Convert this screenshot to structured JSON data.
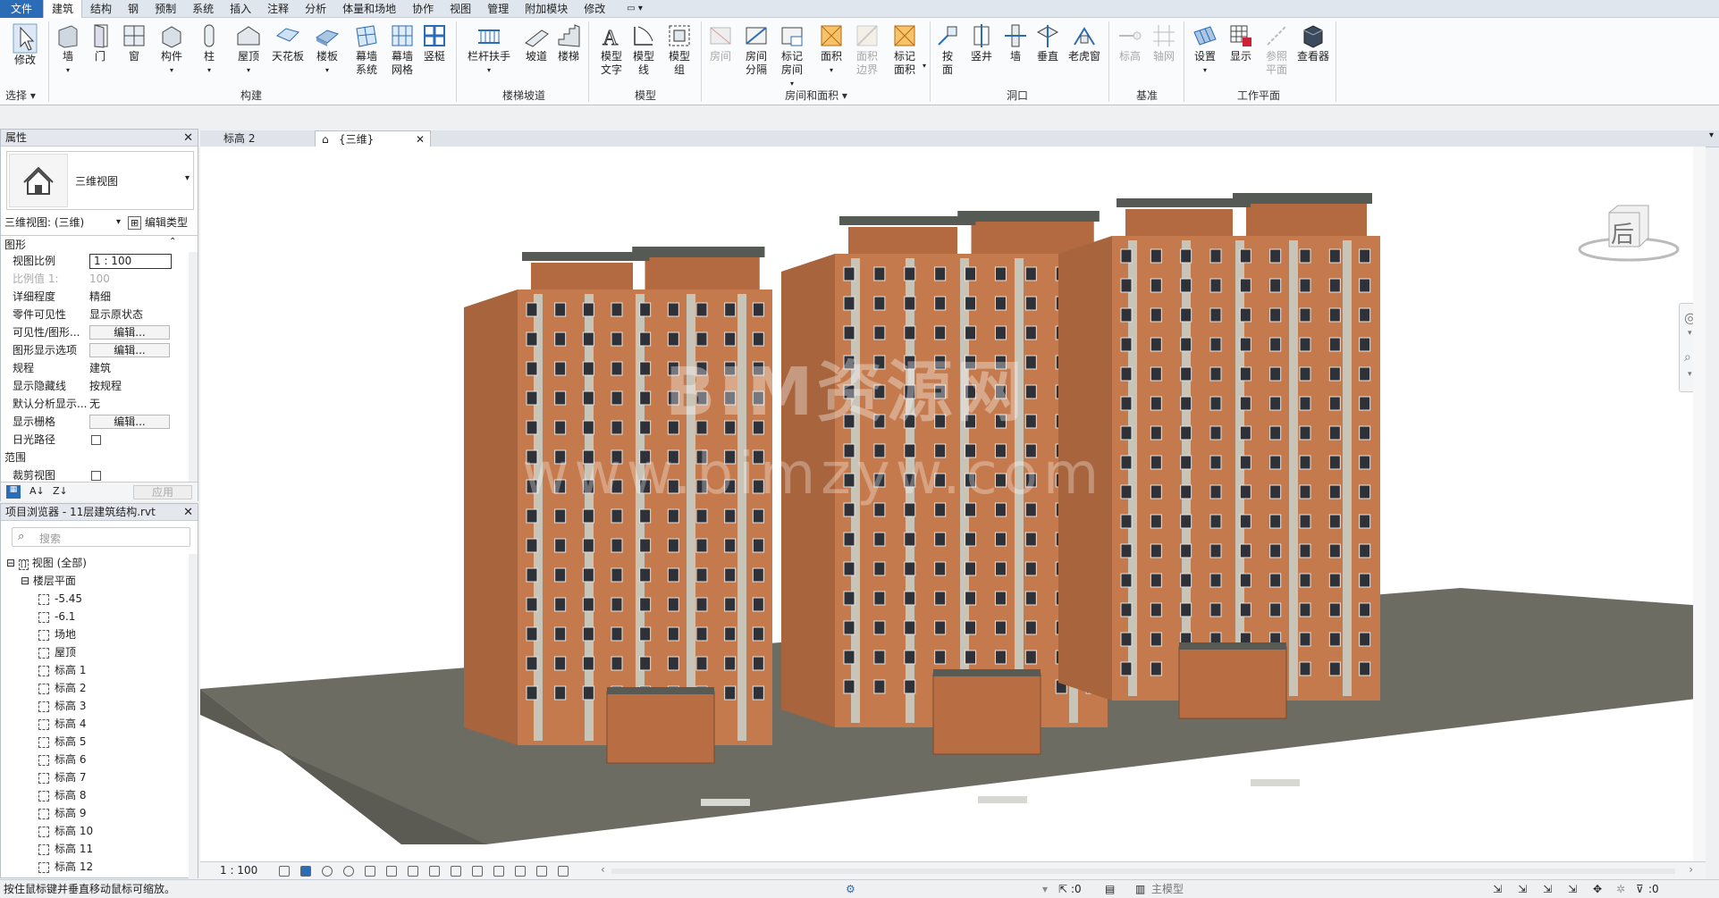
{
  "menubar": {
    "items": [
      "文件",
      "建筑",
      "结构",
      "钢",
      "预制",
      "系统",
      "插入",
      "注释",
      "分析",
      "体量和场地",
      "协作",
      "视图",
      "管理",
      "附加模块",
      "修改"
    ]
  },
  "ribbon": {
    "modify": "修改",
    "select": "选择",
    "build": {
      "label": "构建",
      "tools": [
        "墙",
        "门",
        "窗",
        "构件",
        "柱",
        "屋顶",
        "天花板",
        "楼板",
        "幕墙\n系统",
        "幕墙\n网格",
        "竖梃"
      ]
    },
    "stairs": {
      "label": "楼梯坡道",
      "tools": [
        "栏杆扶手",
        "坡道",
        "楼梯"
      ]
    },
    "model": {
      "label": "模型",
      "tools": [
        "模型\n文字",
        "模型\n线",
        "模型\n组"
      ]
    },
    "room": {
      "label": "房间和面积",
      "tools": [
        "房间",
        "房间\n分隔",
        "标记\n房间",
        "面积",
        "面积\n边界",
        "标记\n面积"
      ]
    },
    "opening": {
      "label": "洞口",
      "tools": [
        "按\n面",
        "竖井",
        "墙",
        "垂直",
        "老虎窗"
      ]
    },
    "datum": {
      "label": "基准",
      "tools": [
        "标高",
        "轴网"
      ]
    },
    "workplane": {
      "label": "工作平面",
      "tools": [
        "设置",
        "显示",
        "参照\n平面",
        "查看器"
      ]
    }
  },
  "properties": {
    "title": "属性",
    "type_name": "三维视图",
    "selector": "三维视图: (三维)",
    "edit_type": "编辑类型",
    "section_graphics": "图形",
    "rows": [
      {
        "k": "视图比例",
        "v": "1 : 100"
      },
      {
        "k": "比例值 1:",
        "v": "100"
      },
      {
        "k": "详细程度",
        "v": "精细"
      },
      {
        "k": "零件可见性",
        "v": "显示原状态"
      },
      {
        "k": "可见性/图形...",
        "v": "编辑..."
      },
      {
        "k": "图形显示选项",
        "v": "编辑..."
      },
      {
        "k": "规程",
        "v": "建筑"
      },
      {
        "k": "显示隐藏线",
        "v": "按规程"
      },
      {
        "k": "默认分析显示...",
        "v": "无"
      },
      {
        "k": "显示栅格",
        "v": "编辑..."
      },
      {
        "k": "日光路径",
        "v": ""
      }
    ],
    "section_extents": "范围",
    "crop_view": "裁剪视图",
    "apply": "应用"
  },
  "browser": {
    "title": "项目浏览器 - 11层建筑结构.rvt",
    "search_placeholder": "搜索",
    "root": "视图 (全部)",
    "floor_plans": "楼层平面",
    "items": [
      "-5.45",
      "-6.1",
      "场地",
      "屋顶",
      "标高 1",
      "标高 2",
      "标高 3",
      "标高 4",
      "标高 5",
      "标高 6",
      "标高 7",
      "标高 8",
      "标高 9",
      "标高 10",
      "标高 11",
      "标高 12"
    ]
  },
  "tabs": [
    {
      "label": "标高 2"
    },
    {
      "label": "{三维}"
    }
  ],
  "viewcube": {
    "face": "后"
  },
  "watermark": {
    "line1": "BIM资源网",
    "line2": "www.bimzyw.com"
  },
  "viewbar": {
    "scale": "1 : 100"
  },
  "status": {
    "hint": "按住鼠标键并垂直移动鼠标可缩放。",
    "zero1": ":0",
    "model": "主模型",
    "zero2": ":0"
  },
  "colors": {
    "brick": "#c47a4c",
    "ground": "#6d6c63",
    "accent": "#2b6cb7"
  }
}
